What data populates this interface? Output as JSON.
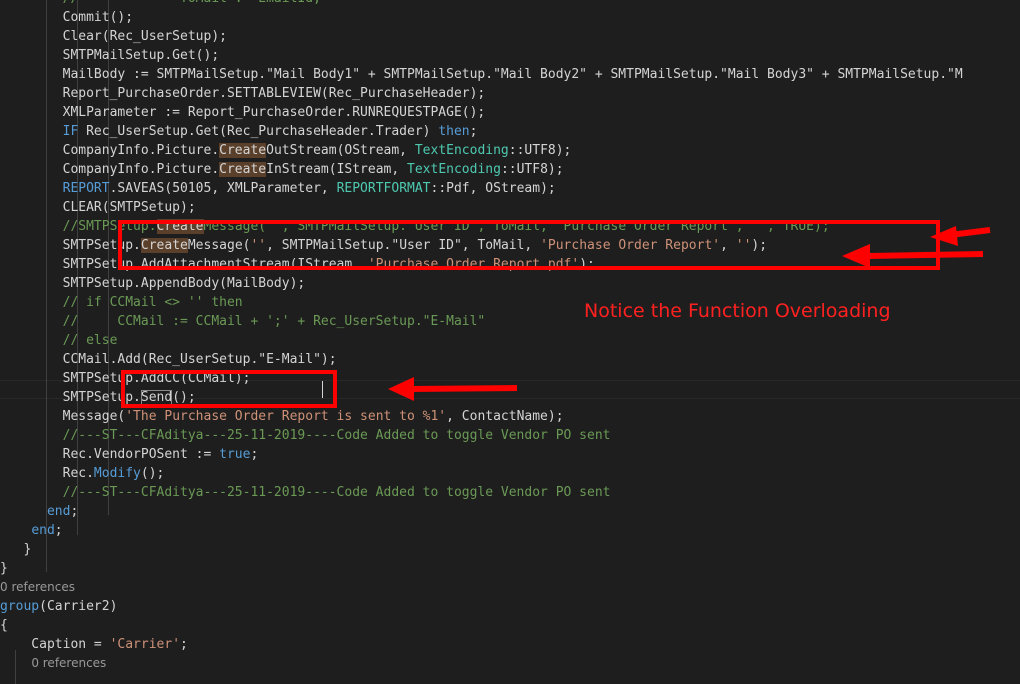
{
  "colors": {
    "background": "#1e1e1e",
    "keyword": "#569cd6",
    "string": "#ce9178",
    "comment": "#6a9955",
    "type": "#4ec9b0",
    "annotation": "#ff0000"
  },
  "annotation": {
    "note": "Notice the Function Overloading"
  },
  "code_lines": [
    [
      {
        "t": "        //             ",
        "c": "t-com"
      },
      {
        "t": "ToMail := EmailId;",
        "c": "t-com"
      }
    ],
    [
      {
        "t": "        Commit();",
        "c": "t-plain"
      }
    ],
    [
      {
        "t": "        Clear(Rec_UserSetup);",
        "c": "t-plain"
      }
    ],
    [
      {
        "t": "        SMTPMailSetup.Get();",
        "c": "t-plain"
      }
    ],
    [
      {
        "t": "        MailBody := SMTPMailSetup.\"Mail Body1\" + SMTPMailSetup.\"Mail Body2\" + SMTPMailSetup.\"Mail Body3\" + SMTPMailSetup.\"M",
        "c": "t-plain"
      }
    ],
    [
      {
        "t": "        Report_PurchaseOrder.SETTABLEVIEW(Rec_PurchaseHeader);",
        "c": "t-plain"
      }
    ],
    [
      {
        "t": "        XMLParameter := Report_PurchaseOrder.RUNREQUESTPAGE();",
        "c": "t-plain"
      }
    ],
    [
      {
        "t": "        ",
        "c": "t-plain"
      },
      {
        "t": "IF",
        "c": "t-kw"
      },
      {
        "t": " Rec_UserSetup.Get(Rec_PurchaseHeader.Trader) ",
        "c": "t-plain"
      },
      {
        "t": "then",
        "c": "t-kw"
      },
      {
        "t": ";",
        "c": "t-plain"
      }
    ],
    [
      {
        "t": "        CompanyInfo.Picture.",
        "c": "t-plain"
      },
      {
        "t": "Create",
        "c": "t-hl"
      },
      {
        "t": "OutStream(OStream, ",
        "c": "t-plain"
      },
      {
        "t": "TextEncoding",
        "c": "t-type"
      },
      {
        "t": "::UTF8);",
        "c": "t-plain"
      }
    ],
    [
      {
        "t": "        CompanyInfo.Picture.",
        "c": "t-plain"
      },
      {
        "t": "Create",
        "c": "t-hl"
      },
      {
        "t": "InStream(IStream, ",
        "c": "t-plain"
      },
      {
        "t": "TextEncoding",
        "c": "t-type"
      },
      {
        "t": "::UTF8);",
        "c": "t-plain"
      }
    ],
    [
      {
        "t": "        ",
        "c": "t-plain"
      },
      {
        "t": "REPORT",
        "c": "t-kw"
      },
      {
        "t": ".SAVEAS(50105, XMLParameter, ",
        "c": "t-plain"
      },
      {
        "t": "REPORTFORMAT",
        "c": "t-type"
      },
      {
        "t": "::Pdf, OStream);",
        "c": "t-plain"
      }
    ],
    [
      {
        "t": "        CLEAR(SMTPSetup);",
        "c": "t-plain"
      }
    ],
    [
      {
        "t": "        //SMTPSetup.",
        "c": "t-com"
      },
      {
        "t": "Create",
        "c": "t-hl"
      },
      {
        "t": "Message('', SMTPMailSetup.\"User ID\", ToMail, 'Purchase Order Report', '', TRUE);",
        "c": "t-com"
      }
    ],
    [
      {
        "t": "        SMTPSetup.",
        "c": "t-plain"
      },
      {
        "t": "Create",
        "c": "t-hl"
      },
      {
        "t": "Message(",
        "c": "t-plain"
      },
      {
        "t": "''",
        "c": "t-str"
      },
      {
        "t": ", SMTPMailSetup.\"User ID\", ToMail, ",
        "c": "t-plain"
      },
      {
        "t": "'Purchase Order Report'",
        "c": "t-str"
      },
      {
        "t": ", ",
        "c": "t-plain"
      },
      {
        "t": "''",
        "c": "t-str"
      },
      {
        "t": ");",
        "c": "t-plain"
      }
    ],
    [
      {
        "t": "        SMTPSetup.AddAttachmentStream(IStream, ",
        "c": "t-plain"
      },
      {
        "t": "'Purchase Order Report.pdf'",
        "c": "t-str"
      },
      {
        "t": ");",
        "c": "t-plain"
      }
    ],
    [
      {
        "t": "        SMTPSetup.AppendBody(MailBody);",
        "c": "t-plain"
      }
    ],
    [
      {
        "t": "        // if CCMail <> '' then",
        "c": "t-com"
      }
    ],
    [
      {
        "t": "        //     CCMail := CCMail + ';' + Rec_UserSetup.\"E-Mail\"",
        "c": "t-com"
      }
    ],
    [
      {
        "t": "        // else",
        "c": "t-com"
      }
    ],
    [
      {
        "t": "        CCMail.Add(Rec_UserSetup.\"E-Mail\");",
        "c": "t-plain"
      }
    ],
    [
      {
        "t": "        SMTPSetup.AddCC(CCMail);",
        "c": "t-plain"
      }
    ],
    [
      {
        "t": "        SMTPSetup.",
        "c": "t-plain"
      },
      {
        "t": "Send",
        "c": "t-boxed"
      },
      {
        "t": "();",
        "c": "t-plain"
      }
    ],
    [
      {
        "t": "        Message(",
        "c": "t-plain"
      },
      {
        "t": "'The Purchase Order Report is sent to %1'",
        "c": "t-str"
      },
      {
        "t": ", ContactName);",
        "c": "t-plain"
      }
    ],
    [
      {
        "t": "        //---ST---CFAditya---25-11-2019----Code Added to toggle Vendor PO sent",
        "c": "t-com"
      }
    ],
    [
      {
        "t": "        Rec.VendorPOSent := ",
        "c": "t-plain"
      },
      {
        "t": "true",
        "c": "t-kw"
      },
      {
        "t": ";",
        "c": "t-plain"
      }
    ],
    [
      {
        "t": "        Rec.",
        "c": "t-plain"
      },
      {
        "t": "Modify",
        "c": "t-kw"
      },
      {
        "t": "();",
        "c": "t-plain"
      }
    ],
    [
      {
        "t": "        //---ST---CFAditya---25-11-2019----Code Added to toggle Vendor PO sent",
        "c": "t-com"
      }
    ],
    [
      {
        "t": "      ",
        "c": "t-plain"
      },
      {
        "t": "end",
        "c": "t-kw"
      },
      {
        "t": ";",
        "c": "t-plain"
      }
    ],
    [
      {
        "t": "    ",
        "c": "t-plain"
      },
      {
        "t": "end",
        "c": "t-kw"
      },
      {
        "t": ";",
        "c": "t-plain"
      }
    ],
    [
      {
        "t": "   }",
        "c": "t-plain"
      }
    ],
    [
      {
        "t": "}",
        "c": "t-plain"
      }
    ],
    [
      {
        "t": "0 references",
        "c": "t-codelens"
      }
    ],
    [
      {
        "t": "group",
        "c": "t-kw"
      },
      {
        "t": "(Carrier2)",
        "c": "t-plain"
      }
    ],
    [
      {
        "t": "{",
        "c": "t-plain"
      }
    ],
    [
      {
        "t": "    Caption = ",
        "c": "t-plain"
      },
      {
        "t": "'Carrier'",
        "c": "t-str"
      },
      {
        "t": ";",
        "c": "t-plain"
      }
    ],
    [
      {
        "t": "    ",
        "c": "t-plain"
      },
      {
        "t": "0 references",
        "c": "t-codelens"
      }
    ]
  ]
}
